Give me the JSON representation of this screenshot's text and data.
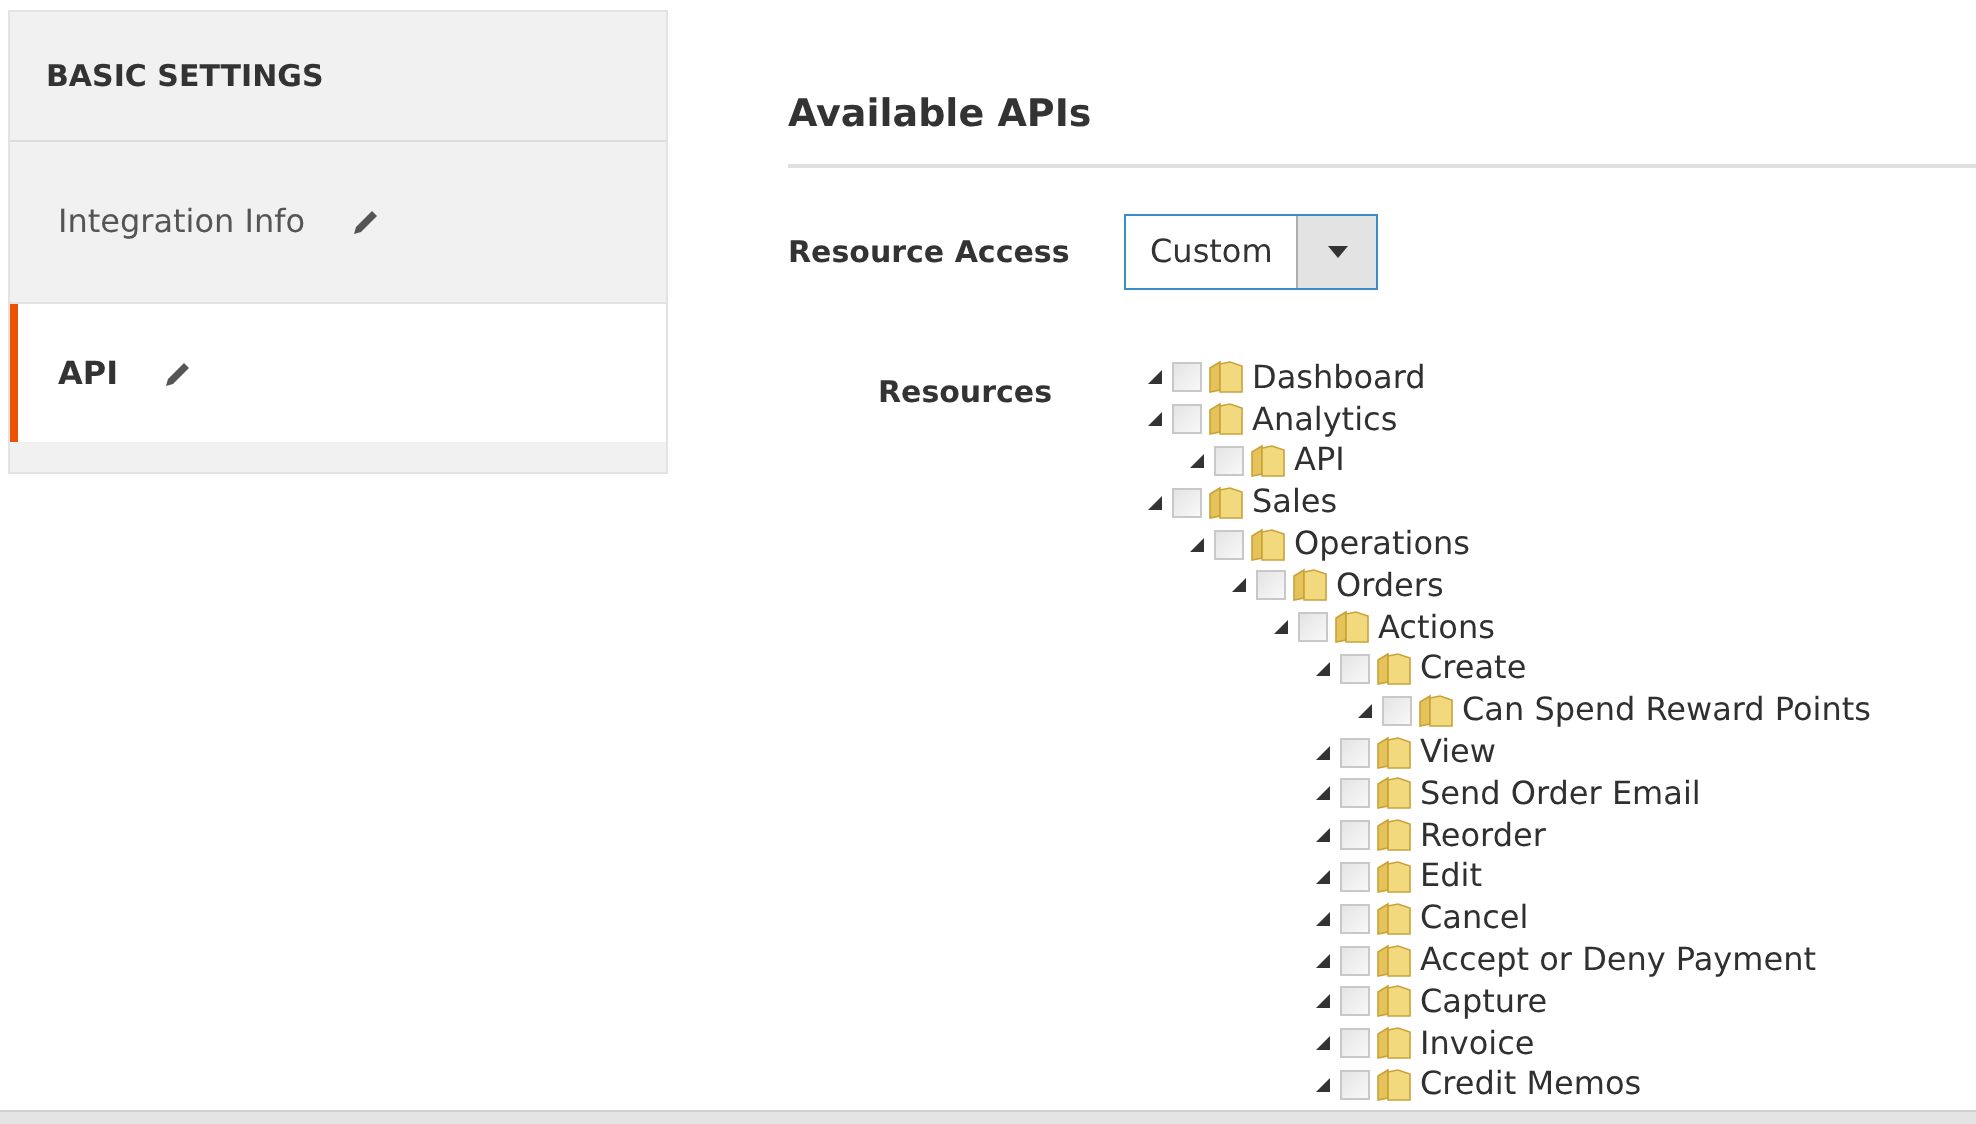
{
  "sidebar": {
    "title": "BASIC SETTINGS",
    "items": [
      {
        "label": "Integration Info",
        "selected": false
      },
      {
        "label": "API",
        "selected": true
      }
    ]
  },
  "section": {
    "title": "Available APIs"
  },
  "resource_access": {
    "label": "Resource Access",
    "value": "Custom"
  },
  "resources": {
    "label": "Resources",
    "tree": [
      {
        "label": "Dashboard",
        "expanded": true,
        "checked": false
      },
      {
        "label": "Analytics",
        "expanded": true,
        "checked": false,
        "children": [
          {
            "label": "API",
            "expanded": true,
            "checked": false
          }
        ]
      },
      {
        "label": "Sales",
        "expanded": true,
        "checked": false,
        "children": [
          {
            "label": "Operations",
            "expanded": true,
            "checked": false,
            "children": [
              {
                "label": "Orders",
                "expanded": true,
                "checked": false,
                "children": [
                  {
                    "label": "Actions",
                    "expanded": true,
                    "checked": false,
                    "children": [
                      {
                        "label": "Create",
                        "expanded": true,
                        "checked": false,
                        "children": [
                          {
                            "label": "Can Spend Reward Points",
                            "expanded": true,
                            "checked": false
                          }
                        ]
                      },
                      {
                        "label": "View",
                        "expanded": true,
                        "checked": false
                      },
                      {
                        "label": "Send Order Email",
                        "expanded": true,
                        "checked": false
                      },
                      {
                        "label": "Reorder",
                        "expanded": true,
                        "checked": false
                      },
                      {
                        "label": "Edit",
                        "expanded": true,
                        "checked": false
                      },
                      {
                        "label": "Cancel",
                        "expanded": true,
                        "checked": false
                      },
                      {
                        "label": "Accept or Deny Payment",
                        "expanded": true,
                        "checked": false
                      },
                      {
                        "label": "Capture",
                        "expanded": true,
                        "checked": false
                      },
                      {
                        "label": "Invoice",
                        "expanded": true,
                        "checked": false
                      },
                      {
                        "label": "Credit Memos",
                        "expanded": true,
                        "checked": false
                      }
                    ]
                  }
                ]
              }
            ]
          }
        ]
      }
    ]
  }
}
